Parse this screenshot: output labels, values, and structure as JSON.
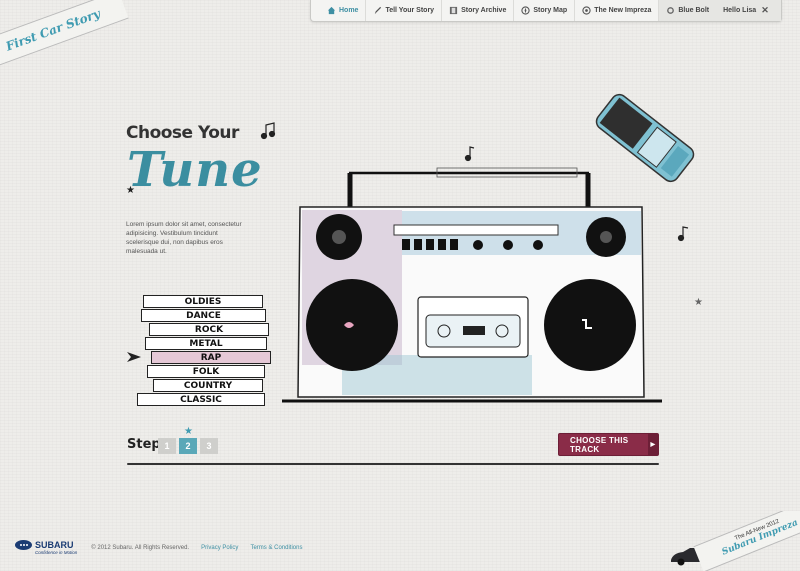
{
  "nav": {
    "items": [
      {
        "label": "Home",
        "icon": "home-icon"
      },
      {
        "label": "Tell Your Story",
        "icon": "pencil-icon"
      },
      {
        "label": "Story Archive",
        "icon": "film-icon"
      },
      {
        "label": "Story Map",
        "icon": "compass-icon"
      },
      {
        "label": "The New Impreza",
        "icon": "car-icon"
      }
    ],
    "user": {
      "car": "Blue Bolt",
      "greeting": "Hello Lisa",
      "close": "✕"
    }
  },
  "ribbon": {
    "title": "First Car Story"
  },
  "hero": {
    "choose": "Choose Your",
    "tune": "Tune",
    "body": "Lorem ipsum dolor sit amet, consectetur adipisicing. Vestibulum tincidunt scelerisque dui, non dapibus eros malesuada ut."
  },
  "tapes": [
    "OLDIES",
    "DANCE",
    "ROCK",
    "METAL",
    "RAP",
    "FOLK",
    "COUNTRY",
    "CLASSIC"
  ],
  "steps": {
    "label": "Step",
    "items": [
      "1",
      "2",
      "3"
    ],
    "active_index": 1
  },
  "cta": {
    "label": "CHOOSE THIS TRACK",
    "arrow": "▶"
  },
  "footer": {
    "brand": "SUBARU",
    "tagline": "Confidence in Motion",
    "copyright": "© 2012 Subaru. All Rights Reserved.",
    "privacy": "Privacy Policy",
    "terms": "Terms & Conditions"
  },
  "promo": {
    "top": "The All-New 2012",
    "name": "Subaru Impreza"
  },
  "colors": {
    "accent": "#3b8ea0",
    "cta": "#8a2c48",
    "brand": "#1a3b73"
  }
}
